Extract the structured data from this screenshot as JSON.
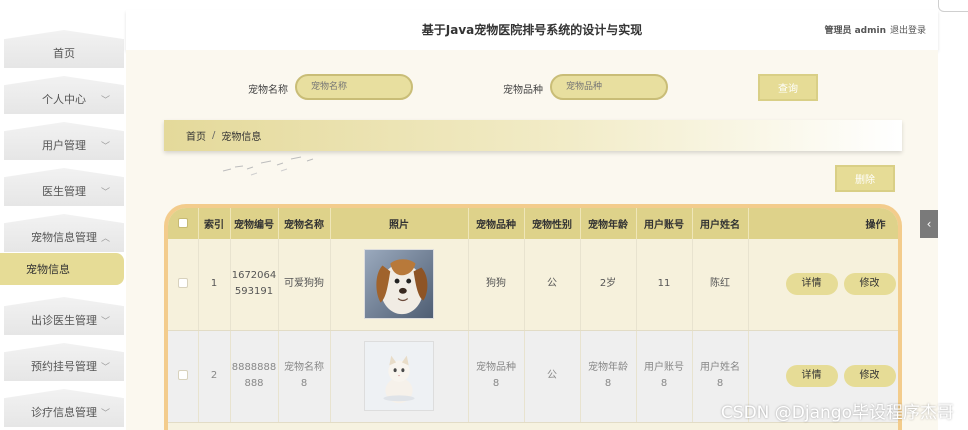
{
  "header": {
    "title": "基于Java宠物医院排号系统的设计与实现",
    "user": "管理员 admin",
    "logout": "退出登录"
  },
  "sidebar": {
    "items": [
      {
        "label": "首页",
        "has_arrow": false
      },
      {
        "label": "个人中心",
        "arrow": "﹀"
      },
      {
        "label": "用户管理",
        "arrow": "﹀"
      },
      {
        "label": "医生管理",
        "arrow": "﹀"
      },
      {
        "label": "宠物信息管理",
        "arrow": "︿"
      },
      {
        "label": "出诊医生管理",
        "arrow": "﹀"
      },
      {
        "label": "预约挂号管理",
        "arrow": "﹀"
      },
      {
        "label": "诊疗信息管理",
        "arrow": "﹀"
      }
    ],
    "active_sub": "宠物信息"
  },
  "search": {
    "name_label": "宠物名称",
    "name_placeholder": "宠物名称",
    "breed_label": "宠物品种",
    "breed_placeholder": "宠物品种",
    "query_button": "查询"
  },
  "breadcrumb": {
    "home": "首页",
    "separator": "/",
    "current": "宠物信息"
  },
  "toolbar": {
    "delete_button": "删除"
  },
  "table": {
    "columns": [
      "索引",
      "宠物编号",
      "宠物名称",
      "照片",
      "宠物品种",
      "宠物性别",
      "宠物年龄",
      "用户账号",
      "用户姓名",
      "操作"
    ],
    "rows": [
      {
        "index": "1",
        "pet_id_1": "1672064",
        "pet_id_2": "593191",
        "pet_name": "可爱狗狗",
        "photo": "dog-photo",
        "breed": "狗狗",
        "gender": "公",
        "age": "2岁",
        "account": "11",
        "owner": "陈红",
        "detail": "详情",
        "edit": "修改"
      },
      {
        "index": "2",
        "pet_id_1": "8888888",
        "pet_id_2": "888",
        "pet_name_1": "宠物名称",
        "pet_name_2": "8",
        "photo": "cat-photo",
        "breed_1": "宠物品种",
        "breed_2": "8",
        "gender": "公",
        "age_1": "宠物年龄",
        "age_2": "8",
        "account_1": "用户账号",
        "account_2": "8",
        "owner_1": "用户姓名",
        "owner_2": "8",
        "detail": "详情",
        "edit": "修改"
      }
    ]
  },
  "collapse_icon": "chevron-left-icon",
  "watermark": "CSDN @Django毕设程序杰哥",
  "colors": {
    "accent": "#e6dc96",
    "table_border": "#f3cc8c",
    "header_bg": "#ded28a"
  }
}
